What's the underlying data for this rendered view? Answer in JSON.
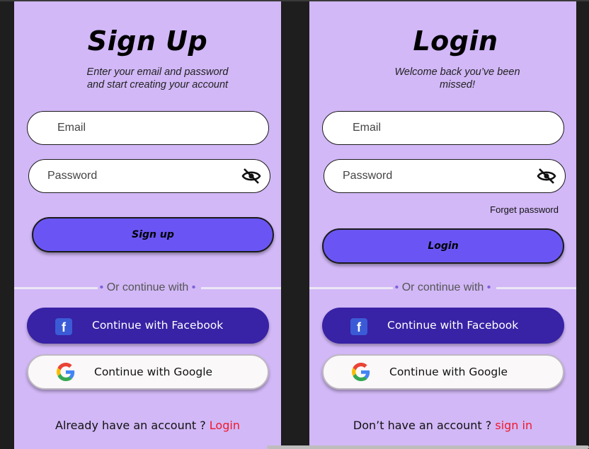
{
  "signup": {
    "title": "Sign Up",
    "subtitle_line1": "Enter your email and password",
    "subtitle_line2": "and start creating your account",
    "email_placeholder": "Email",
    "password_placeholder": "Password",
    "submit_label": "Sign up",
    "divider_text": "Or continue with",
    "facebook_label": "Continue with Facebook",
    "google_label": "Continue with Google",
    "footer_text": "Already have an account ?",
    "footer_link": "Login"
  },
  "login": {
    "title": "Login",
    "subtitle_line1": "Welcome back you’ve been",
    "subtitle_line2": "missed!",
    "email_placeholder": "Email",
    "password_placeholder": "Password",
    "forget_label": "Forget password",
    "submit_label": "Login",
    "divider_text": "Or continue with",
    "facebook_label": "Continue with Facebook",
    "google_label": "Continue with Google",
    "footer_text": "Don’t have an account ?",
    "footer_link": "sign in"
  },
  "icons": {
    "password_toggle": "eye-off-icon",
    "facebook": "facebook-icon",
    "google": "google-icon"
  },
  "colors": {
    "panel_bg": "#d2b8f7",
    "primary_button": "#6a55f4",
    "facebook_button": "#3822a5",
    "link": "#f0182a",
    "canvas_bg": "#1e1e1e"
  }
}
